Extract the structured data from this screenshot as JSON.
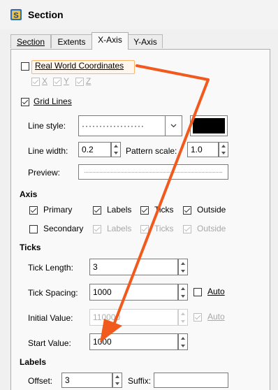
{
  "window": {
    "title": "Section",
    "icon": "section-app-icon"
  },
  "tabs": [
    {
      "label": "Section",
      "active": false
    },
    {
      "label": "Extents",
      "active": false
    },
    {
      "label": "X-Axis",
      "active": true
    },
    {
      "label": "Y-Axis",
      "active": false
    }
  ],
  "real_world": {
    "label": "Real World Coordinates",
    "checked": false,
    "sub": [
      {
        "label": "X",
        "checked": true
      },
      {
        "label": "Y",
        "checked": true
      },
      {
        "label": "Z",
        "checked": true
      }
    ]
  },
  "grid": {
    "label": "Grid Lines",
    "checked": true,
    "line_style_label": "Line style:",
    "line_style_value": "··················",
    "line_color": "#000000",
    "line_width_label": "Line width:",
    "line_width_value": "0.2",
    "pattern_scale_label": "Pattern scale:",
    "pattern_scale_value": "1.0",
    "preview_label": "Preview:"
  },
  "axis": {
    "heading": "Axis",
    "primary": {
      "label": "Primary",
      "checked": true,
      "labels": "Labels",
      "ticks": "Ticks",
      "outside": "Outside"
    },
    "secondary": {
      "label": "Secondary",
      "checked": false,
      "labels": "Labels",
      "ticks": "Ticks",
      "outside": "Outside"
    }
  },
  "ticks": {
    "heading": "Ticks",
    "tick_length_label": "Tick Length:",
    "tick_length_value": "3",
    "tick_spacing_label": "Tick Spacing:",
    "tick_spacing_value": "1000",
    "auto_label": "Auto",
    "initial_value_label": "Initial Value:",
    "initial_value_value": "110000",
    "start_value_label": "Start Value:",
    "start_value_value": "1000"
  },
  "labels": {
    "heading": "Labels",
    "offset_label": "Offset:",
    "offset_value": "3",
    "suffix_label": "Suffix:",
    "suffix_value": ""
  },
  "annotation": {
    "arrow_color": "#f25a1d"
  }
}
